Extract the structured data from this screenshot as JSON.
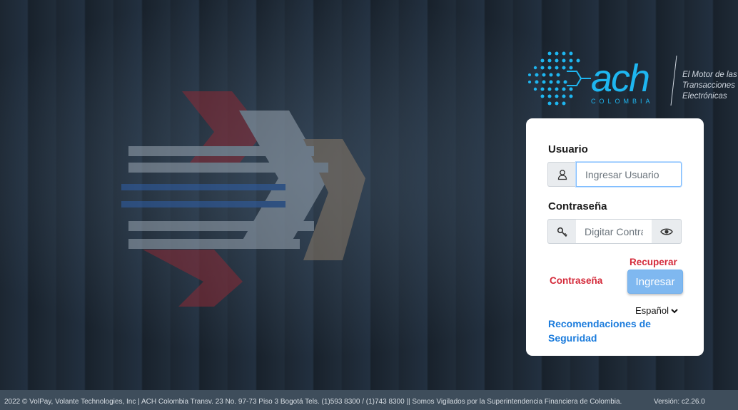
{
  "logo": {
    "brand": "ach",
    "sub": "COLOMBIA",
    "tagline": [
      "El Motor de las",
      "Transacciones",
      "Electrónicas"
    ]
  },
  "login": {
    "user_label": "Usuario",
    "user_placeholder": "Ingresar Usuario",
    "password_label": "Contraseña",
    "password_placeholder": "Digitar Contraseña",
    "recover_line1": "Recuperar",
    "recover_line2": "Contraseña",
    "submit_label": "Ingresar",
    "language": "Español",
    "security_link": "Recomendaciones de Seguridad"
  },
  "icons": {
    "user": "user-icon",
    "key": "key-icon",
    "eye": "eye-icon",
    "chevron": "chevron-down-icon"
  },
  "colors": {
    "accent": "#7fb8f0",
    "link_red": "#d42a3a",
    "link_blue": "#1a7bdc",
    "logo_blue": "#1eb6f0"
  },
  "footer": {
    "copyright": "2022 © VolPay, Volante Technologies, Inc | ACH Colombia Transv. 23 No. 97-73 Piso 3 Bogotá Tels. (1)593 8300 / (1)743 8300 || Somos Vigilados por la Superintendencia Financiera de Colombia.",
    "version": "Versión: c2.26.0"
  }
}
